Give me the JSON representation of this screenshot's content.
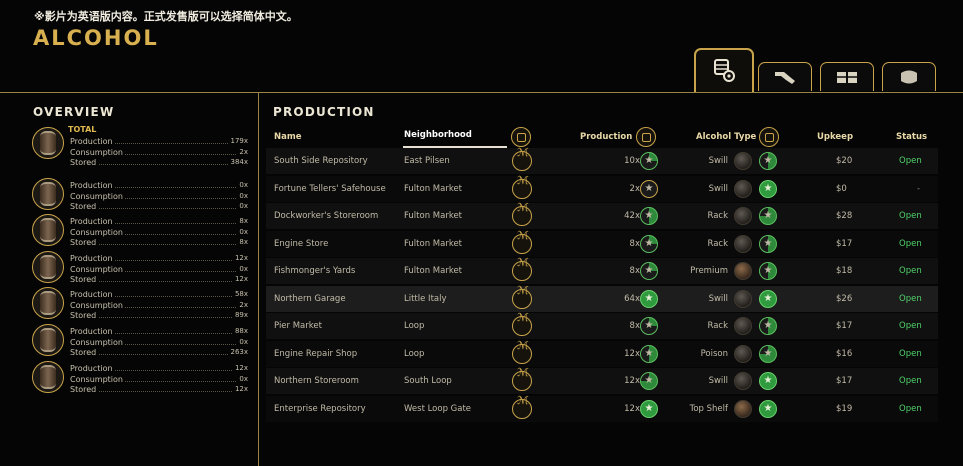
{
  "notice": "※影片为英语版内容。正式发售版可以选择简体中文。",
  "title": "ALCOHOL",
  "tabs": [
    {
      "icon": "distillery-gear-icon",
      "active": true
    },
    {
      "icon": "bottle-pour-icon",
      "active": false
    },
    {
      "icon": "crates-icon",
      "active": false
    },
    {
      "icon": "glove-icon",
      "active": false
    }
  ],
  "overview": {
    "heading": "OVERVIEW",
    "total_label": "TOTAL",
    "labels": {
      "production": "Production",
      "consumption": "Consumption",
      "stored": "Stored"
    },
    "rows": [
      {
        "icon": "total-cake-icon",
        "production": "179x",
        "consumption": "2x",
        "stored": "384x"
      },
      {
        "icon": "swill-barrel-icon",
        "production": "0x",
        "consumption": "0x",
        "stored": "0x"
      },
      {
        "icon": "rack-crate-icon",
        "production": "8x",
        "consumption": "0x",
        "stored": "8x"
      },
      {
        "icon": "premium-crate-icon",
        "production": "12x",
        "consumption": "0x",
        "stored": "12x"
      },
      {
        "icon": "barrel-icon",
        "production": "58x",
        "consumption": "2x",
        "stored": "89x"
      },
      {
        "icon": "poison-barrel-icon",
        "production": "88x",
        "consumption": "0x",
        "stored": "263x"
      },
      {
        "icon": "top-shelf-barrel-icon",
        "production": "12x",
        "consumption": "0x",
        "stored": "12x"
      }
    ]
  },
  "production": {
    "heading": "PRODUCTION",
    "headers": {
      "name": "Name",
      "neighborhood": "Neighborhood",
      "production": "Production",
      "alcohol_type": "Alcohol Type",
      "upkeep": "Upkeep",
      "status": "Status"
    },
    "rows": [
      {
        "name": "South Side Repository",
        "neighborhood": "East Pilsen",
        "production": "10x",
        "quality": 1,
        "type": "Swill",
        "upkeep": "$20",
        "status": "Open"
      },
      {
        "name": "Fortune Tellers' Safehouse",
        "neighborhood": "Fulton Market",
        "production": "2x",
        "quality": 0,
        "type": "Swill",
        "upkeep": "$0",
        "status": "-"
      },
      {
        "name": "Dockworker's Storeroom",
        "neighborhood": "Fulton Market",
        "production": "42x",
        "quality": 2,
        "type": "Rack",
        "upkeep": "$28",
        "status": "Open"
      },
      {
        "name": "Engine Store",
        "neighborhood": "Fulton Market",
        "production": "8x",
        "quality": 1,
        "type": "Rack",
        "upkeep": "$17",
        "status": "Open"
      },
      {
        "name": "Fishmonger's Yards",
        "neighborhood": "Fulton Market",
        "production": "8x",
        "quality": 1,
        "type": "Premium",
        "upkeep": "$18",
        "status": "Open"
      },
      {
        "name": "Northern Garage",
        "neighborhood": "Little Italy",
        "production": "64x",
        "quality": 4,
        "type": "Swill",
        "upkeep": "$26",
        "status": "Open"
      },
      {
        "name": "Pier Market",
        "neighborhood": "Loop",
        "production": "8x",
        "quality": 1,
        "type": "Rack",
        "upkeep": "$17",
        "status": "Open"
      },
      {
        "name": "Engine Repair Shop",
        "neighborhood": "Loop",
        "production": "12x",
        "quality": 2,
        "type": "Poison",
        "upkeep": "$16",
        "status": "Open"
      },
      {
        "name": "Northern Storeroom",
        "neighborhood": "South Loop",
        "production": "12x",
        "quality": 3,
        "type": "Swill",
        "upkeep": "$17",
        "status": "Open"
      },
      {
        "name": "Enterprise Repository",
        "neighborhood": "West Loop Gate",
        "production": "12x",
        "quality": 4,
        "type": "Top Shelf",
        "upkeep": "$19",
        "status": "Open"
      }
    ]
  },
  "colors": {
    "gold": "#c9a44a",
    "open_green": "#4fd26a",
    "background": "#050505"
  }
}
